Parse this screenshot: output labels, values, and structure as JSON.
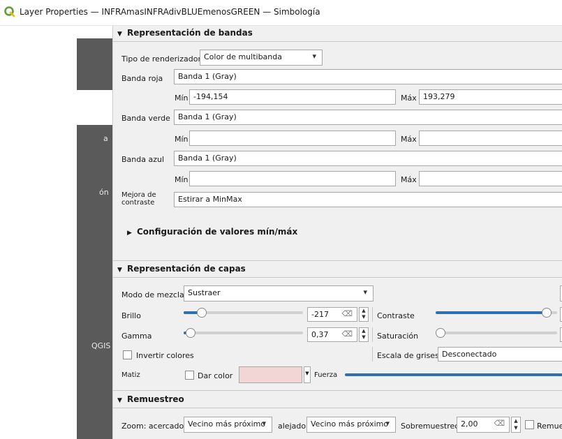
{
  "window": {
    "title": "Layer Properties — INFRAmasINFRAdivBLUEmenosGREEN — Simbología",
    "icon": "qgis-logo-icon"
  },
  "sidebar": {
    "partial_labels": [
      "a",
      "ón",
      "QGIS"
    ]
  },
  "band_rendering": {
    "header": "Representación de bandas",
    "renderer_type_label": "Tipo de renderizador",
    "renderer_type_value": "Color de multibanda",
    "red_band_label": "Banda roja",
    "red_band_value": "Banda 1 (Gray)",
    "green_band_label": "Banda verde",
    "green_band_value": "Banda 1 (Gray)",
    "blue_band_label": "Banda azul",
    "blue_band_value": "Banda 1 (Gray)",
    "min_label": "Mín",
    "max_label": "Máx",
    "red_min": "-194,154",
    "red_max": "193,279",
    "green_min": "",
    "green_max": "",
    "blue_min": "",
    "blue_max": "",
    "contrast_label": "Mejora de\ncontraste",
    "contrast_value": "Estirar a MinMax",
    "minmax_settings": "Configuración de valores mín/máx"
  },
  "layer_rendering": {
    "header": "Representación de capas",
    "blend_mode_label": "Modo de mezcla",
    "blend_mode_value": "Sustraer",
    "brightness_label": "Brillo",
    "brightness_value": "-217",
    "contrast_label": "Contraste",
    "gamma_label": "Gamma",
    "gamma_value": "0,37",
    "saturation_label": "Saturación",
    "invert_colors_label": "Invertir colores",
    "grayscale_label": "Escala de grises",
    "grayscale_value": "Desconectado",
    "hue_label": "Matiz",
    "colorize_label": "Dar color",
    "strength_label": "Fuerza",
    "colorize_swatch": "#f2d6d6",
    "brightness_level": 0.12,
    "gamma_level": 0.02,
    "contrast_level": 0.95,
    "saturation_level": 0.0,
    "accent": "#2e6fb0"
  },
  "resampling": {
    "header": "Remuestreo",
    "zoom_in_label": "Zoom: acercado",
    "zoom_in_value": "Vecino más próximo",
    "zoom_out_label": "alejado",
    "zoom_out_value": "Vecino más próximo",
    "oversampling_label": "Sobremuestreo",
    "oversampling_value": "2,00",
    "early_resampling_label": "Remue"
  }
}
